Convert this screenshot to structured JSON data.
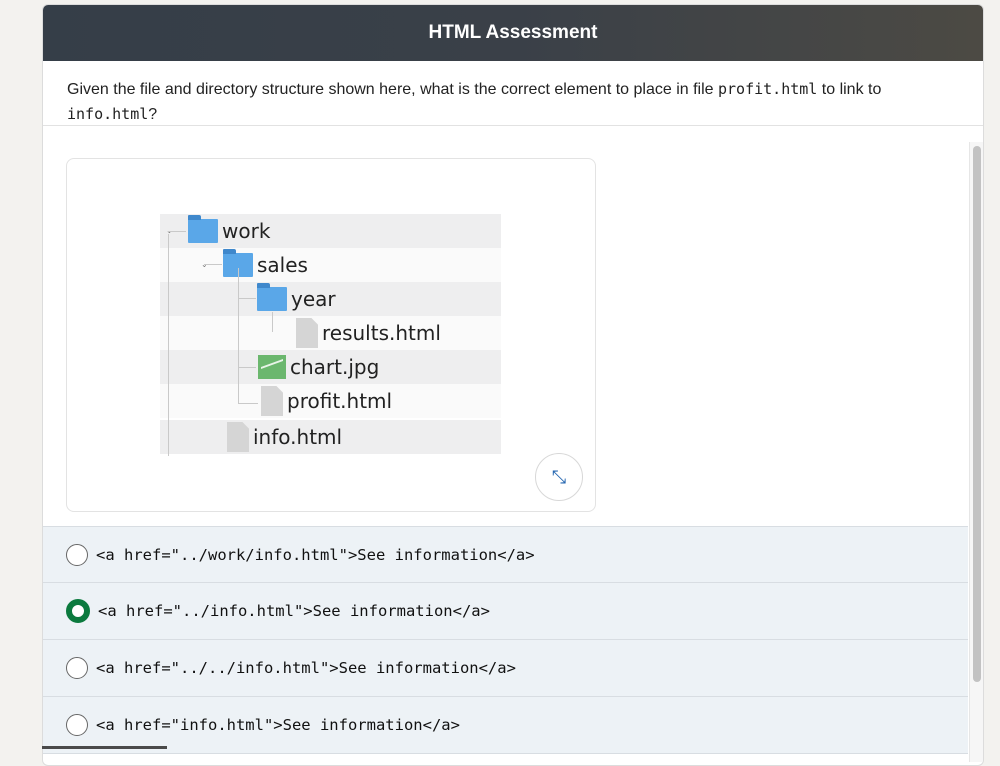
{
  "header": {
    "title": "HTML Assessment"
  },
  "question": {
    "part1": "Given the file and directory structure shown here, what is the correct element to place in file ",
    "code1": "profit.html",
    "part2": " to link to ",
    "code2": "info.html",
    "part3": "?"
  },
  "tree": {
    "work": "work",
    "sales": "sales",
    "year": "year",
    "results": "results.html",
    "chart": "chart.jpg",
    "profit": "profit.html",
    "info": "info.html"
  },
  "icons": {
    "folder": "folder-icon",
    "file": "file-icon",
    "image": "image-icon",
    "expand": "expand-icon"
  },
  "colors": {
    "selected_radio": "#0b7a3e",
    "folder": "#5aa7e8",
    "header_bg": "#353e48"
  },
  "options": [
    {
      "text": "<a href=\"../work/info.html\">See information</a>",
      "selected": false
    },
    {
      "text": "<a href=\"../info.html\">See information</a>",
      "selected": true
    },
    {
      "text": "<a href=\"../../info.html\">See information</a>",
      "selected": false
    },
    {
      "text": "<a href=\"info.html\">See information</a>",
      "selected": false
    }
  ]
}
